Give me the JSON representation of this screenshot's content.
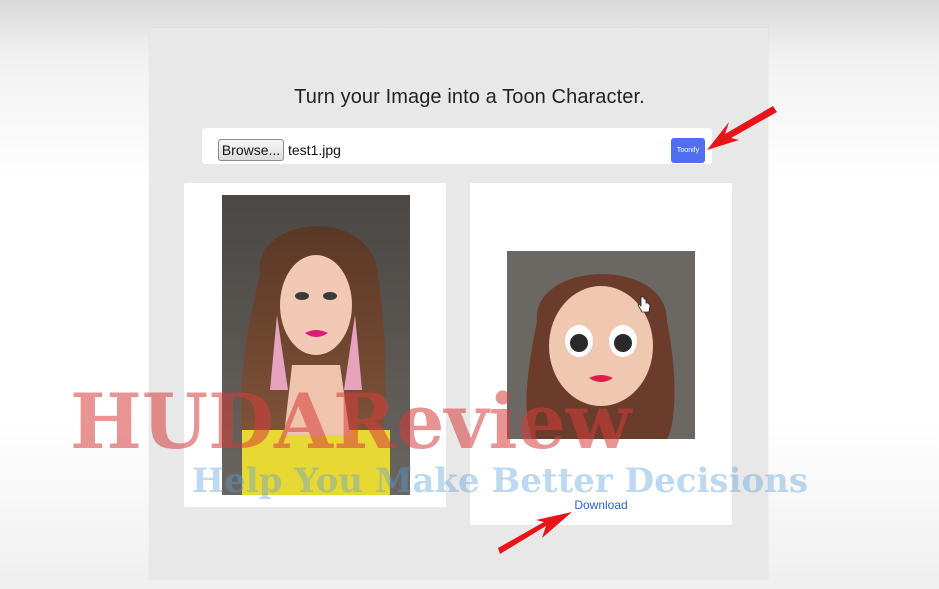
{
  "page": {
    "title": "Turn your Image into a Toon Character."
  },
  "upload": {
    "browse_label": "Browse...",
    "file_name": "test1.jpg",
    "toonify_label": "Toonify"
  },
  "result": {
    "download_label": "Download"
  },
  "watermark": {
    "brand": "HUDAReview",
    "tagline": "Help You Make Better Decisions"
  },
  "colors": {
    "accent": "#4f6ef0",
    "link": "#2a64d8",
    "arrow": "#e8141a",
    "panel": "#e8e8e8"
  },
  "icons": {
    "arrow": "red-arrow-icon",
    "cursor": "hand-cursor-icon"
  }
}
